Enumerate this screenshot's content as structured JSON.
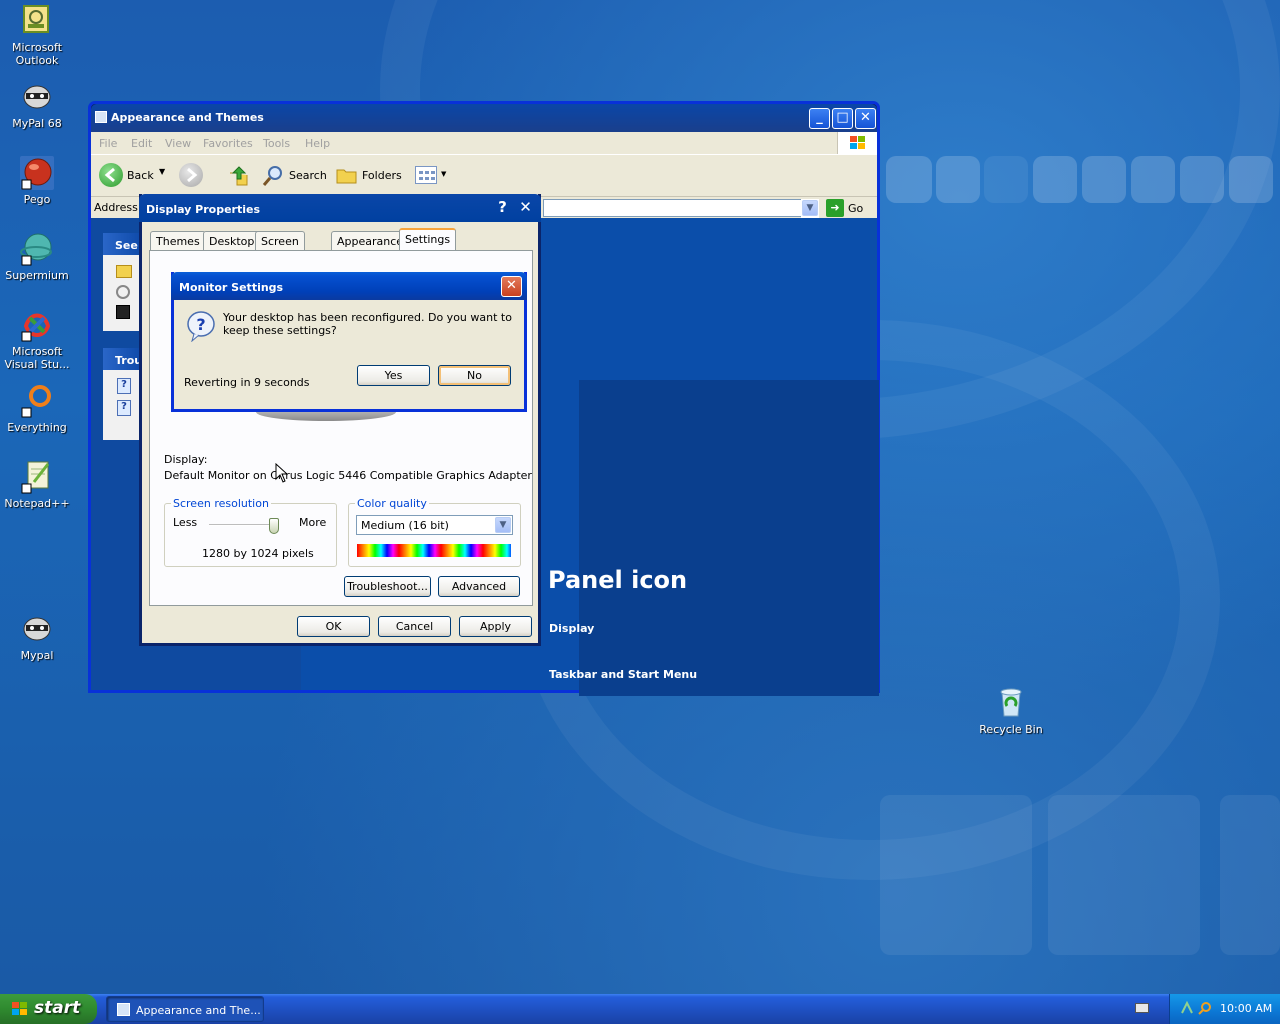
{
  "desktop": {
    "icons": [
      {
        "label": "Microsoft Outlook"
      },
      {
        "label": "MyPal 68"
      },
      {
        "label": "Pego"
      },
      {
        "label": "Supermium"
      },
      {
        "label": "Microsoft Visual Stu..."
      },
      {
        "label": "Everything"
      },
      {
        "label": "Notepad++"
      },
      {
        "label": "Mypal"
      },
      {
        "label": "Recycle Bin"
      }
    ]
  },
  "explorer": {
    "title": "Appearance and Themes",
    "menu": [
      "File",
      "Edit",
      "View",
      "Favorites",
      "Tools",
      "Help"
    ],
    "toolbar": {
      "back": "Back",
      "search": "Search",
      "folders": "Folders"
    },
    "address_label": "Address",
    "go_label": "Go",
    "left_pane": {
      "see_also": "See",
      "troubleshooters": "Trou"
    },
    "main": {
      "heading": "Panel icon",
      "link_display": "Display",
      "link_taskbar": "Taskbar and Start Menu"
    }
  },
  "display_properties": {
    "title": "Display Properties",
    "tabs": [
      "Themes",
      "Desktop",
      "Screen Saver",
      "Appearance",
      "Settings"
    ],
    "active_tab": "Settings",
    "display_label": "Display:",
    "display_value": "Default Monitor on Cirrus Logic 5446 Compatible Graphics Adapter",
    "screen_resolution": {
      "title": "Screen resolution",
      "less": "Less",
      "more": "More",
      "value": "1280 by 1024 pixels",
      "slider_fraction": 1.0
    },
    "color_quality": {
      "title": "Color quality",
      "selected": "Medium (16 bit)"
    },
    "buttons": {
      "troubleshoot": "Troubleshoot...",
      "advanced": "Advanced",
      "ok": "OK",
      "cancel": "Cancel",
      "apply": "Apply"
    }
  },
  "monitor_settings": {
    "title": "Monitor Settings",
    "message": "Your desktop has been reconfigured.  Do you want to keep these settings?",
    "countdown": "Reverting in 9 seconds",
    "yes": "Yes",
    "no": "No"
  },
  "taskbar": {
    "start": "start",
    "task": "Appearance and The...",
    "clock": "10:00 AM"
  },
  "colors": {
    "xp_blue": "#0831d9",
    "desktop": "#1d5aa5",
    "start_green": "#2f8a2f"
  }
}
